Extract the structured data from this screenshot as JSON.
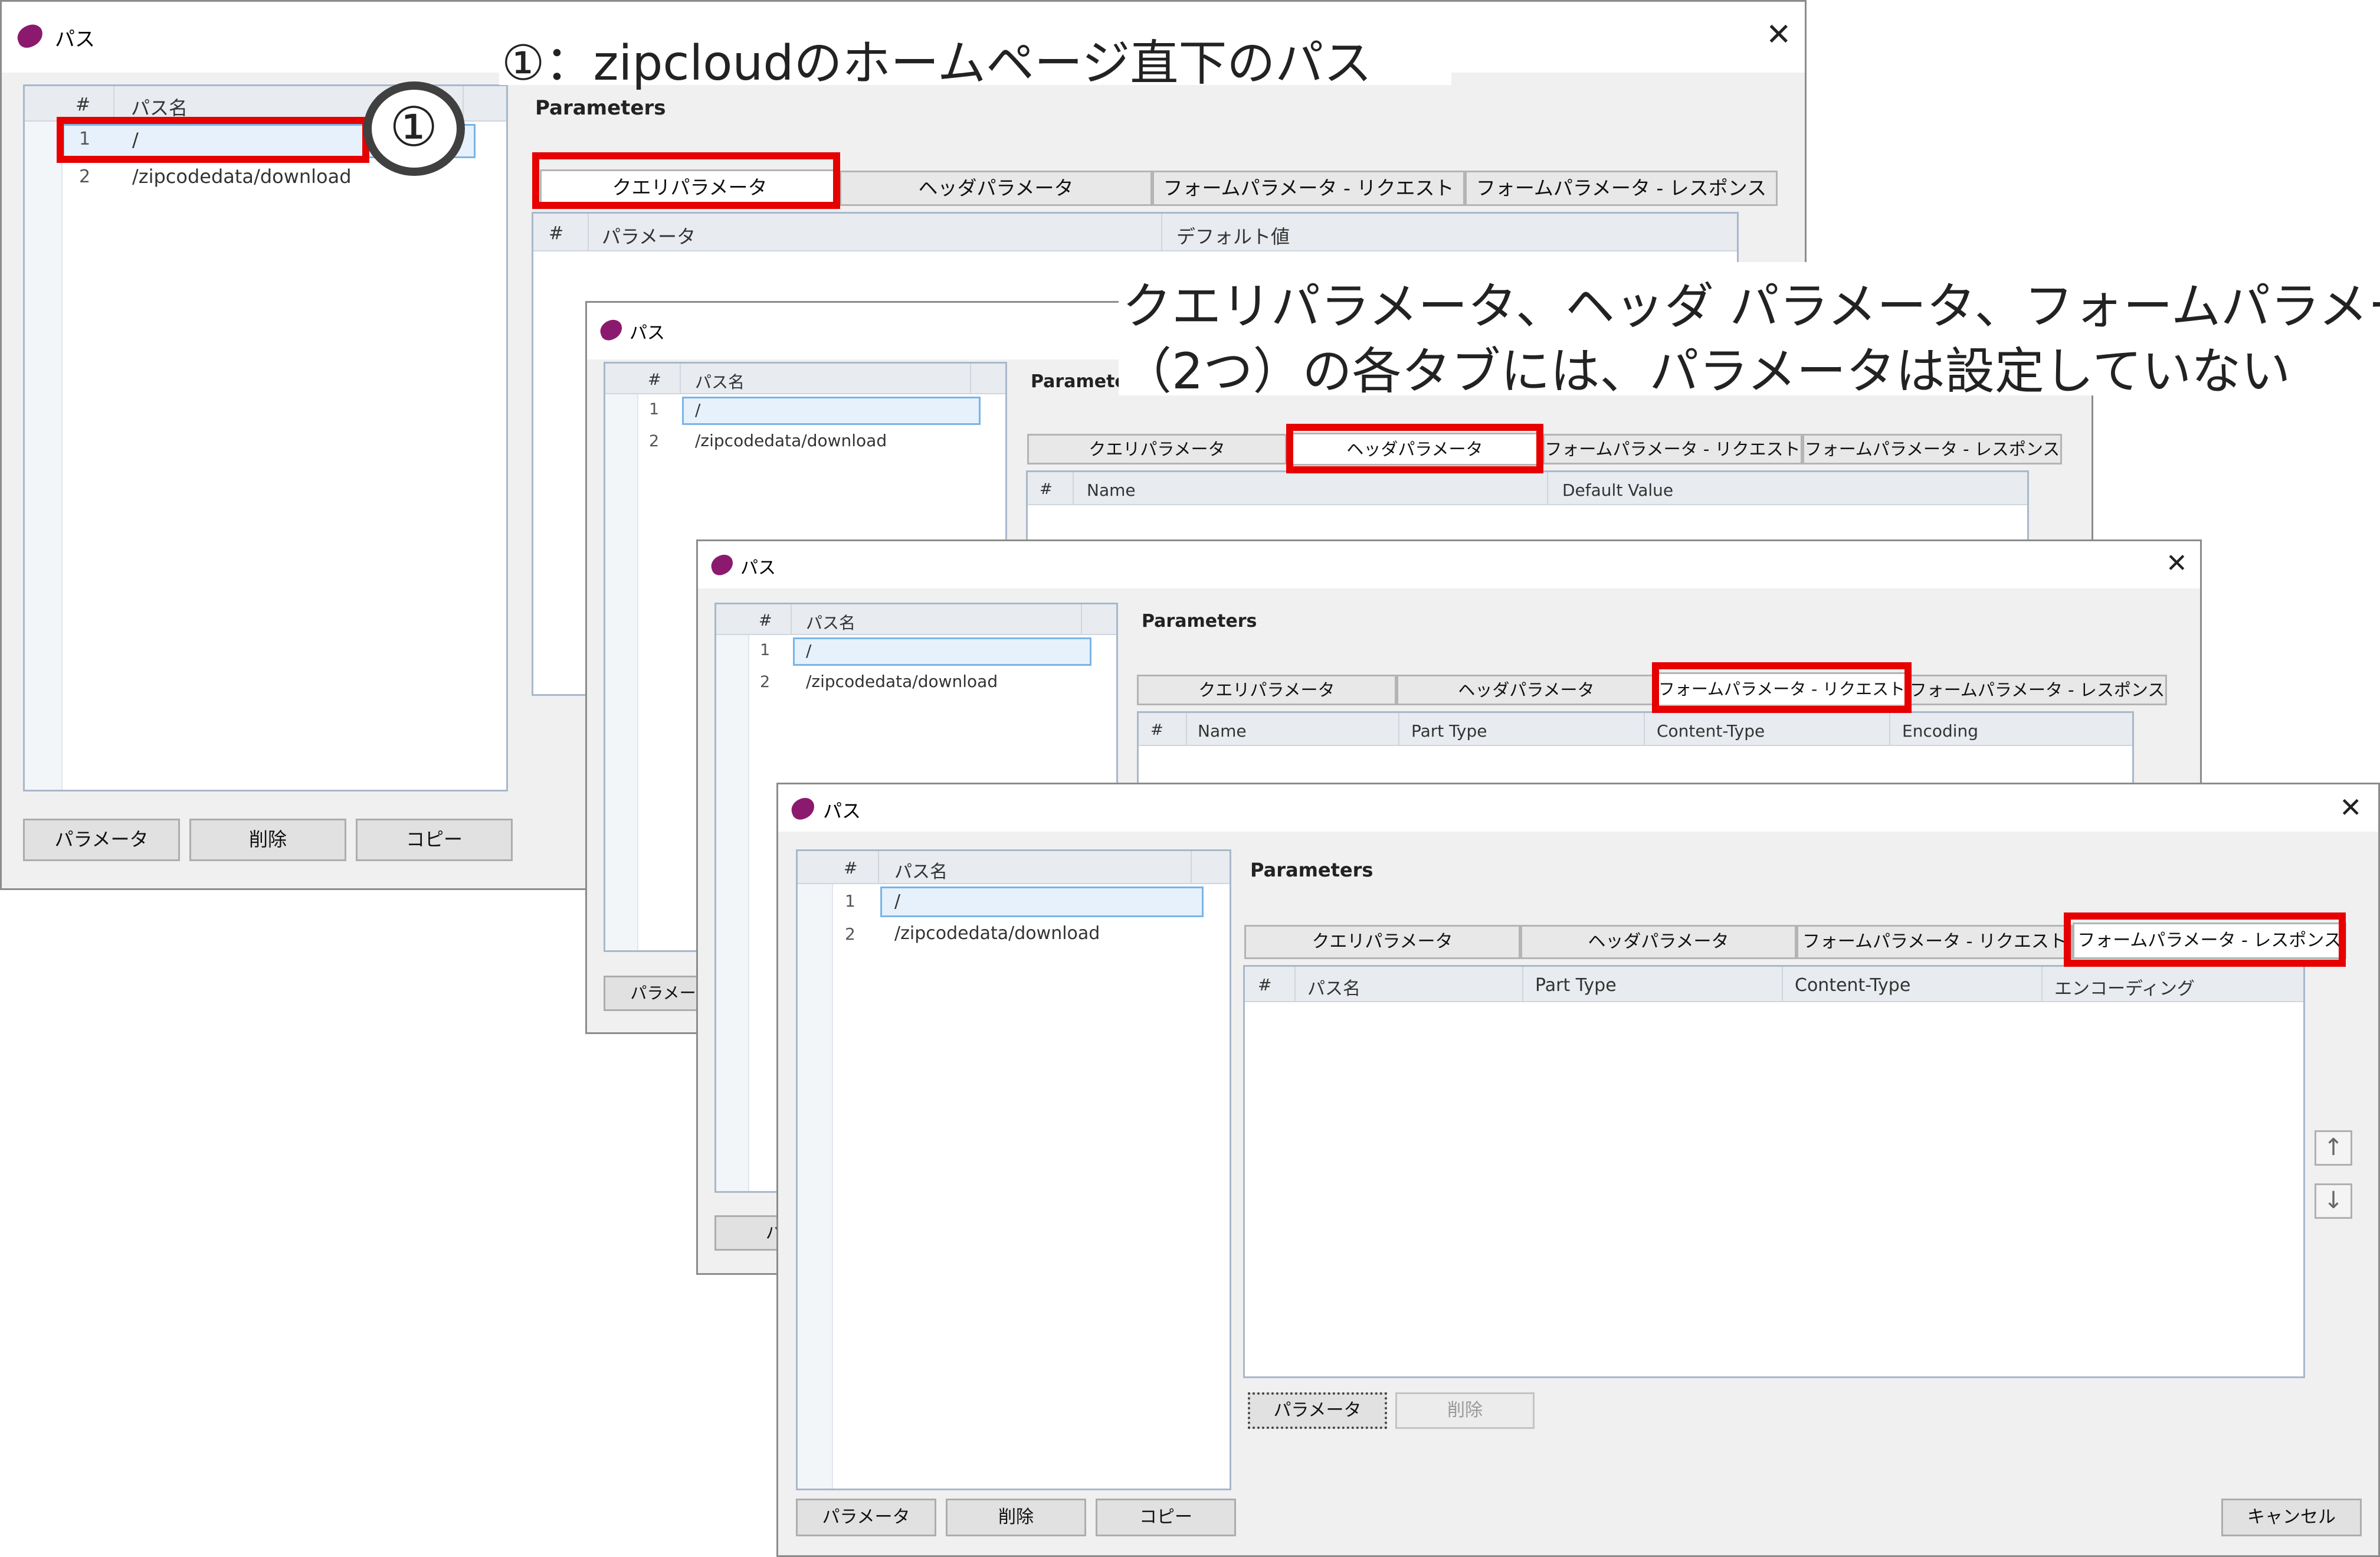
{
  "dialogs": [
    {
      "title": "パス",
      "paths_header": {
        "num": "#",
        "name": "パス名"
      },
      "paths": [
        {
          "num": "1",
          "name": "/"
        },
        {
          "num": "2",
          "name": "/zipcodedata/download"
        }
      ],
      "parameters_label": "Parameters",
      "tabs": [
        "クエリパラメータ",
        "ヘッダパラメータ",
        "フォームパラメータ - リクエスト",
        "フォームパラメータ - レスポンス"
      ],
      "selected_tab": 0,
      "param_header": [
        "#",
        "パラメータ",
        "デフォルト値"
      ],
      "buttons": [
        "パラメータ",
        "削除",
        "コピー"
      ]
    },
    {
      "title": "パス",
      "paths_header": {
        "num": "#",
        "name": "パス名"
      },
      "paths": [
        {
          "num": "1",
          "name": "/"
        },
        {
          "num": "2",
          "name": "/zipcodedata/download"
        }
      ],
      "parameters_label": "Parameters",
      "tabs": [
        "クエリパラメータ",
        "ヘッダパラメータ",
        "フォームパラメータ - リクエスト",
        "フォームパラメータ - レスポンス"
      ],
      "selected_tab": 1,
      "param_header": [
        "#",
        "Name",
        "Default Value"
      ],
      "buttons": [
        "パラメータ"
      ]
    },
    {
      "title": "パス",
      "paths_header": {
        "num": "#",
        "name": "パス名"
      },
      "paths": [
        {
          "num": "1",
          "name": "/"
        },
        {
          "num": "2",
          "name": "/zipcodedata/download"
        }
      ],
      "parameters_label": "Parameters",
      "tabs": [
        "クエリパラメータ",
        "ヘッダパラメータ",
        "フォームパラメータ - リクエスト",
        "フォームパラメータ - レスポンス"
      ],
      "selected_tab": 2,
      "param_header": [
        "#",
        "Name",
        "Part Type",
        "Content-Type",
        "Encoding"
      ],
      "buttons": [
        "パラ"
      ]
    },
    {
      "title": "パス",
      "paths_header": {
        "num": "#",
        "name": "パス名"
      },
      "paths": [
        {
          "num": "1",
          "name": "/"
        },
        {
          "num": "2",
          "name": "/zipcodedata/download"
        }
      ],
      "parameters_label": "Parameters",
      "tabs": [
        "クエリパラメータ",
        "ヘッダパラメータ",
        "フォームパラメータ - リクエスト",
        "フォームパラメータ - レスポンス"
      ],
      "selected_tab": 3,
      "param_header": [
        "#",
        "パス名",
        "Part Type",
        "Content-Type",
        "エンコーディング"
      ],
      "inner_buttons": [
        "パラメータ",
        "削除"
      ],
      "buttons": [
        "パラメータ",
        "削除",
        "コピー"
      ],
      "cancel": "キャンセル"
    }
  ],
  "annotations": {
    "note1": "①：zipcloudのホームページ直下のパス",
    "note2_line1": "クエリパラメータ、ヘッダ パラメータ、フォームパラメータ",
    "note2_line2": "（2つ）の各タブには、パラメータは設定していない",
    "circle_label": "①"
  },
  "icons": {
    "app": "app-logo-icon",
    "close": "close-icon",
    "up": "arrow-up-icon",
    "down": "arrow-down-icon"
  },
  "colors": {
    "highlight": "#e60000",
    "app_icon": "#8b1a6f",
    "selection": "#e6f1fb"
  }
}
